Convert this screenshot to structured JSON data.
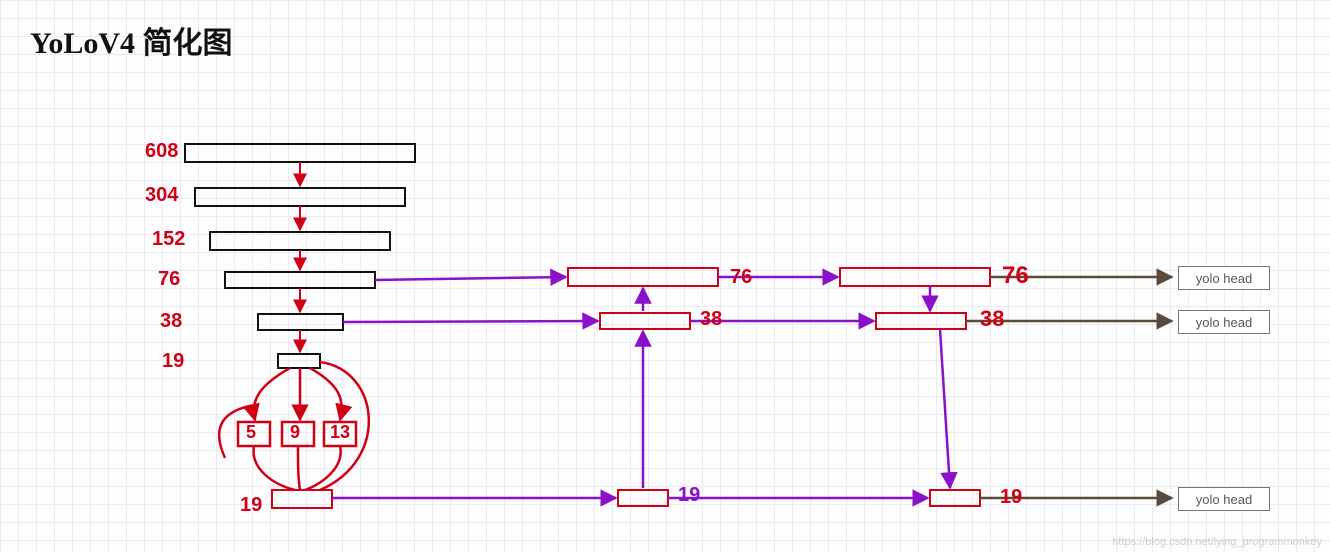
{
  "title": "YoLoV4 简化图",
  "watermark": "https://blog.csdn.net/lying_programmonkey",
  "backbone": {
    "labels": [
      "608",
      "304",
      "152",
      "76",
      "38",
      "19"
    ]
  },
  "spp": {
    "kernels": [
      "5",
      "9",
      "13"
    ],
    "out_label": "19"
  },
  "neck": {
    "col1": {
      "top": "76",
      "mid": "38",
      "bot": "19"
    },
    "col2": {
      "top": "76",
      "mid": "38",
      "bot": "19"
    }
  },
  "heads": [
    "yolo head",
    "yolo head",
    "yolo head"
  ]
}
